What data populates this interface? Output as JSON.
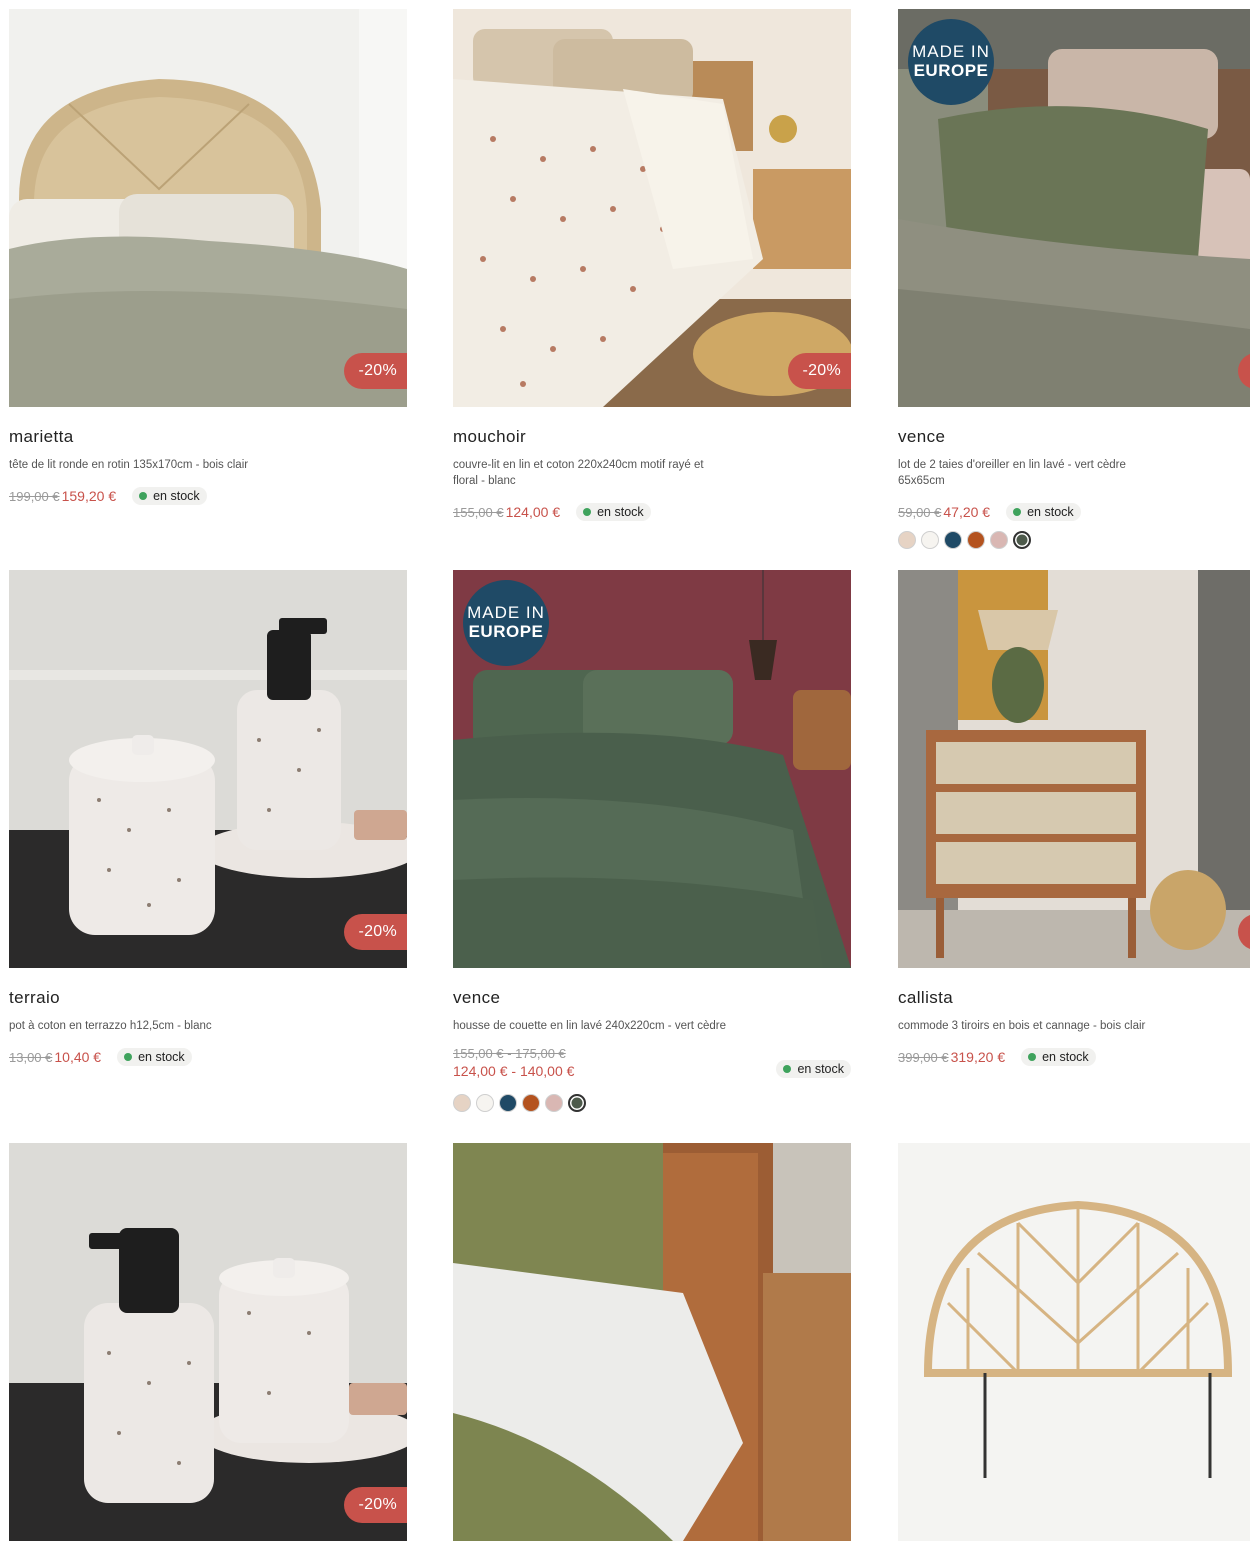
{
  "colors": {
    "discount": "#c8524b",
    "europe_badge": "#1f4a66",
    "stock_dot": "#3fa35d"
  },
  "products": [
    {
      "name": "marietta",
      "desc": "tête de lit ronde en rotin 135x170cm - bois clair",
      "old_price": "199,00 €",
      "price": "159,20 €",
      "stock": "en stock",
      "discount": "-20%"
    },
    {
      "name": "mouchoir",
      "desc": "couvre-lit en lin et coton 220x240cm motif rayé et floral - blanc",
      "old_price": "155,00 €",
      "price": "124,00 €",
      "stock": "en stock",
      "discount": "-20%"
    },
    {
      "name": "vence",
      "desc": "lot de 2 taies d'oreiller en lin lavé - vert cèdre 65x65cm",
      "old_price": "59,00 €",
      "price": "47,20 €",
      "stock": "en stock",
      "badge_l1": "MADE IN",
      "badge_l2": "EUROPE",
      "swatches": [
        "#e6d3c4",
        "#f6f4f0",
        "#1f4a66",
        "#b4531f",
        "#d9b7b3",
        "#4d5a4b"
      ]
    },
    {
      "name": "terraio",
      "desc": "pot à coton en terrazzo h12,5cm - blanc",
      "old_price": "13,00 €",
      "price": "10,40 €",
      "stock": "en stock",
      "discount": "-20%"
    },
    {
      "name": "vence",
      "desc": "housse de couette en lin lavé 240x220cm - vert cèdre",
      "old_price": "155,00 € - 175,00 €",
      "price": "124,00 € - 140,00 €",
      "stock": "en stock",
      "badge_l1": "MADE IN",
      "badge_l2": "EUROPE",
      "swatches": [
        "#e6d3c4",
        "#f6f4f0",
        "#1f4a66",
        "#b4531f",
        "#d9b7b3",
        "#4d5a4b"
      ]
    },
    {
      "name": "callista",
      "desc": "commode 3 tiroirs en bois et cannage - bois clair",
      "old_price": "399,00 €",
      "price": "319,20 €",
      "stock": "en stock"
    },
    {
      "discount": "-20%"
    },
    {},
    {}
  ]
}
